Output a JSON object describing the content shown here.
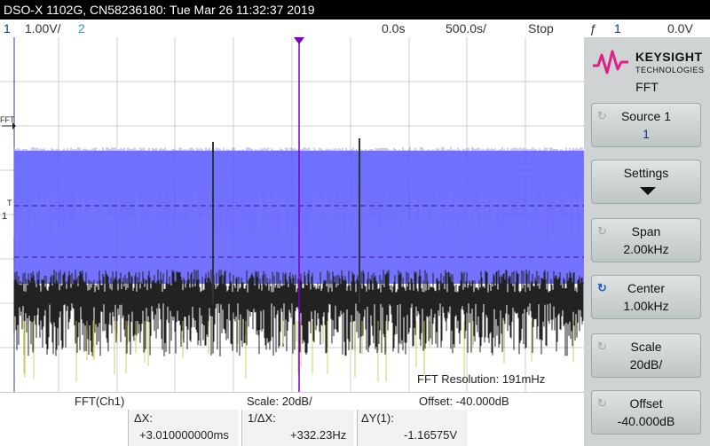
{
  "title": "DSO-X 1102G, CN58236180: Tue Mar 26 11:32:37 2019",
  "status": {
    "ch1_num": "1",
    "ch1_scale": "1.00V/",
    "ch2_num": "2",
    "time_delay": "0.0s",
    "time_scale": "500.0s/",
    "run_state": "Stop",
    "trigger_symbol": "ƒ",
    "trigger_channel": "1",
    "trigger_level": "0.0V"
  },
  "screen": {
    "fft_marker": "FFT",
    "trigger_marker": "T",
    "ch1_marker": "1",
    "fft_resolution": "FFT Resolution: 191mHz",
    "fft_color": "#5a5aff",
    "signal_color": "#222222",
    "cursor_color": "#7a00c8"
  },
  "bottom": {
    "source": "FFT(Ch1)",
    "scale": "Scale: 20dB/",
    "offset": "Offset: -40.000dB"
  },
  "cursors": {
    "dx_label": "ΔX:",
    "dx_value": "+3.010000000ms",
    "inv_dx_label": "1/ΔX:",
    "inv_dx_value": "+332.23Hz",
    "dy_label": "ΔY(1):",
    "dy_value": "-1.16575V"
  },
  "panel": {
    "logo_line1": "KEYSIGHT",
    "logo_line2": "TECHNOLOGIES",
    "menu_title": "FFT",
    "buttons": [
      {
        "label": "Source 1",
        "value": "1"
      },
      {
        "label": "Settings",
        "value": ""
      },
      {
        "label": "Span",
        "value": "2.00kHz"
      },
      {
        "label": "Center",
        "value": "1.00kHz"
      },
      {
        "label": "Scale",
        "value": "20dB/"
      },
      {
        "label": "Offset",
        "value": "-40.000dB"
      }
    ]
  }
}
